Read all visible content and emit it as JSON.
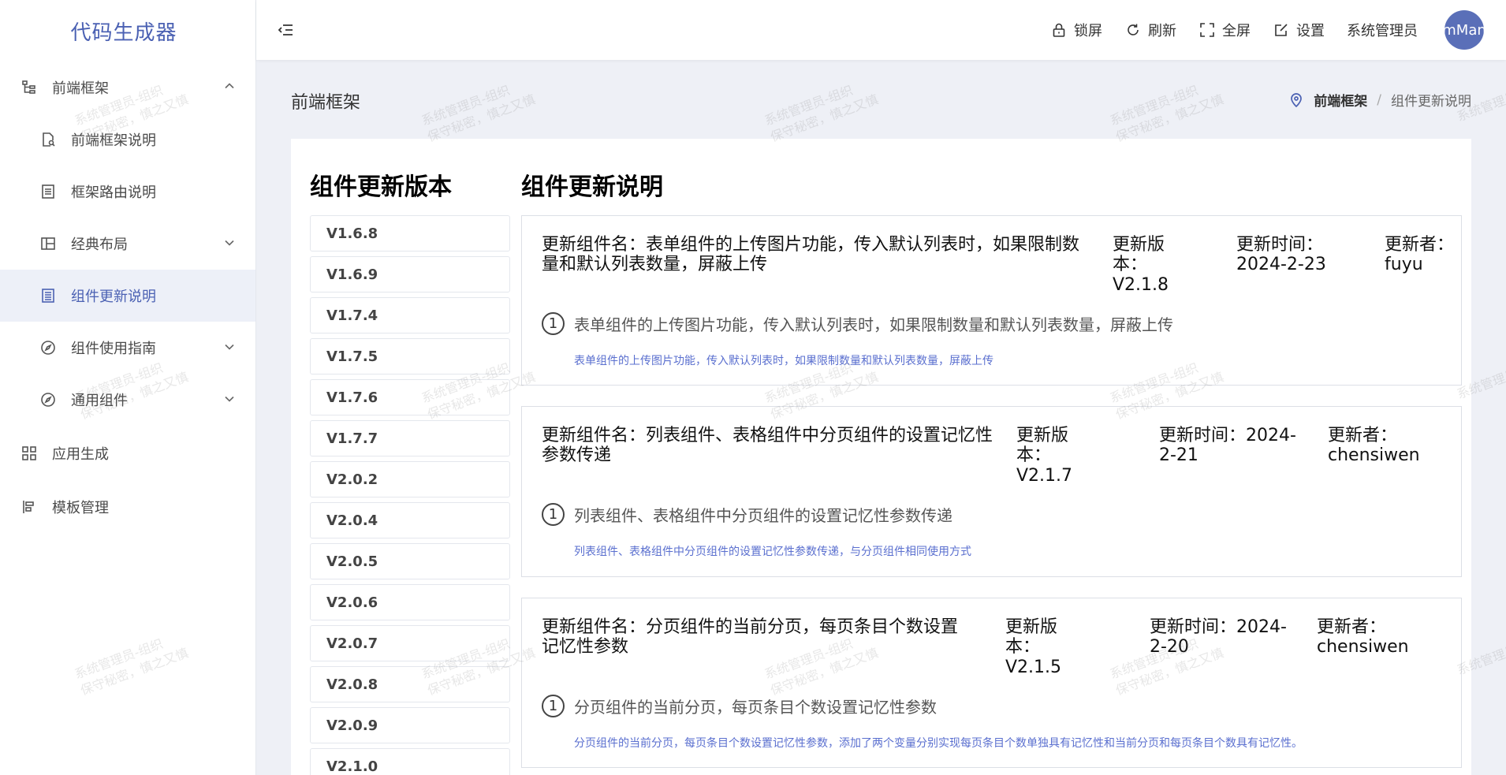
{
  "app": {
    "title": "代码生成器"
  },
  "sidebar": {
    "items": [
      {
        "label": "前端框架",
        "icon": "tree-icon"
      },
      {
        "label": "前端框架说明",
        "icon": "document-search-icon"
      },
      {
        "label": "框架路由说明",
        "icon": "list-doc-icon"
      },
      {
        "label": "经典布局",
        "icon": "layout-icon"
      },
      {
        "label": "组件更新说明",
        "icon": "document-icon"
      },
      {
        "label": "组件使用指南",
        "icon": "compass-icon"
      },
      {
        "label": "通用组件",
        "icon": "compass-icon"
      },
      {
        "label": "应用生成",
        "icon": "grid-icon"
      },
      {
        "label": "模板管理",
        "icon": "align-left-icon"
      }
    ]
  },
  "header": {
    "lock_label": "锁屏",
    "refresh_label": "刷新",
    "fullscreen_label": "全屏",
    "settings_label": "设置",
    "username": "系统管理员",
    "avatar_text": "mMan"
  },
  "page": {
    "title": "前端框架",
    "breadcrumb": [
      "前端框架",
      "组件更新说明"
    ],
    "versions_title": "组件更新版本",
    "desc_title": "组件更新说明"
  },
  "versions": [
    "V1.6.8",
    "V1.6.9",
    "V1.7.4",
    "V1.7.5",
    "V1.7.6",
    "V1.7.7",
    "V2.0.2",
    "V2.0.4",
    "V2.0.5",
    "V2.0.6",
    "V2.0.7",
    "V2.0.8",
    "V2.0.9",
    "V2.1.0"
  ],
  "updates": [
    {
      "name": "更新组件名：表单组件的上传图片功能，传入默认列表时，如果限制数量和默认列表数量，屏蔽上传",
      "version": "更新版本：V2.1.8",
      "time": "更新时间：2024-2-23",
      "author": "更新者：fuyu",
      "item_no": "1",
      "item": "表单组件的上传图片功能，传入默认列表时，如果限制数量和默认列表数量，屏蔽上传",
      "detail": "表单组件的上传图片功能，传入默认列表时，如果限制数量和默认列表数量，屏蔽上传"
    },
    {
      "name": "更新组件名：列表组件、表格组件中分页组件的设置记忆性参数传递",
      "version": "更新版本：V2.1.7",
      "time": "更新时间：2024-2-21",
      "author": "更新者：chensiwen",
      "item_no": "1",
      "item": "列表组件、表格组件中分页组件的设置记忆性参数传递",
      "detail": "列表组件、表格组件中分页组件的设置记忆性参数传递，与分页组件相同使用方式"
    },
    {
      "name": "更新组件名：分页组件的当前分页，每页条目个数设置记忆性参数",
      "version": "更新版本：V2.1.5",
      "time": "更新时间：2024-2-20",
      "author": "更新者：chensiwen",
      "item_no": "1",
      "item": "分页组件的当前分页，每页条目个数设置记忆性参数",
      "detail": "分页组件的当前分页，每页条目个数设置记忆性参数，添加了两个变量分别实现每页条目个数单独具有记忆性和当前分页和每页条目个数具有记忆性。"
    }
  ],
  "watermark": {
    "line1": "系统管理员-组织",
    "line2": "保守秘密，慎之又慎"
  }
}
